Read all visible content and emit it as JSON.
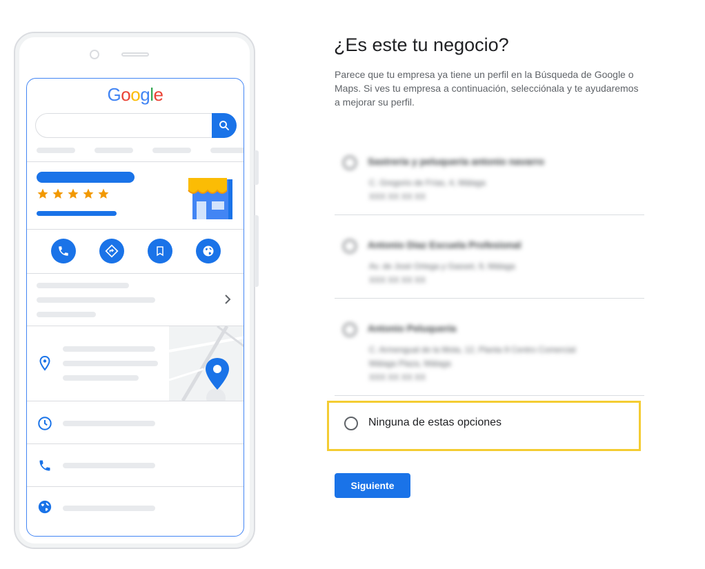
{
  "illustration": {
    "brand_logo": "Google",
    "logo_colors": [
      "#4285F4",
      "#EA4335",
      "#FBBC05",
      "#4285F4",
      "#34A853",
      "#EA4335"
    ],
    "accent_color": "#1A73E8",
    "rating_stars": 5,
    "action_icons": [
      "phone-icon",
      "directions-icon",
      "bookmark-icon",
      "globe-icon"
    ],
    "info_icons": [
      "location-pin-icon",
      "clock-icon",
      "phone-icon",
      "globe-icon"
    ]
  },
  "page": {
    "title": "¿Es este tu negocio?",
    "description": "Parece que tu empresa ya tiene un perfil en la Búsqueda de Google o Maps. Si ves tu empresa a continuación, selecciónala y te ayudaremos a mejorar su perfil."
  },
  "options": [
    {
      "name": "Sastrería y peluquería antonio navarro",
      "lines": [
        "C. Gregorio de Frías, 4, Málaga",
        "XXX XX XX XX"
      ]
    },
    {
      "name": "Antonio Diaz Escuela Profesional",
      "lines": [
        "Av. de José Ortega y Gasset, 9, Málaga",
        "XXX XX XX XX"
      ]
    },
    {
      "name": "Antonio Peluquería",
      "lines": [
        "C. Armengual de la Mota, 12, Planta 9 Centro Comercial",
        "Málaga Plaza, Málaga",
        "XXX XX XX XX"
      ]
    }
  ],
  "none_option": {
    "label": "Ninguna de estas opciones"
  },
  "next_button": {
    "label": "Siguiente"
  },
  "highlight_color": "#F4CC32"
}
